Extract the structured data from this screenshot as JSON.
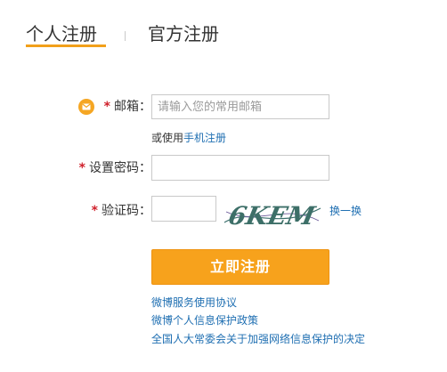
{
  "tabs": [
    {
      "label": "个人注册",
      "active": true
    },
    {
      "label": "官方注册",
      "active": false
    }
  ],
  "form": {
    "required_mark": "*",
    "email": {
      "label": "邮箱：",
      "placeholder": "请输入您的常用邮箱"
    },
    "alt_register": {
      "prefix": "或使用",
      "link": "手机注册"
    },
    "password": {
      "label": "设置密码：",
      "value": ""
    },
    "captcha": {
      "label": "验证码：",
      "value": "",
      "image_text": "6KEM",
      "refresh": "换一换"
    }
  },
  "submit_label": "立即注册",
  "agreements": [
    "微博服务使用协议",
    "微博个人信息保护政策",
    "全国人大常委会关于加强网络信息保护的决定"
  ],
  "colors": {
    "accent": "#f7a21c",
    "link": "#1f6fb2",
    "required": "#d0202b",
    "icon_circle": "#f5a623"
  },
  "icons": {
    "email": "envelope-icon"
  }
}
